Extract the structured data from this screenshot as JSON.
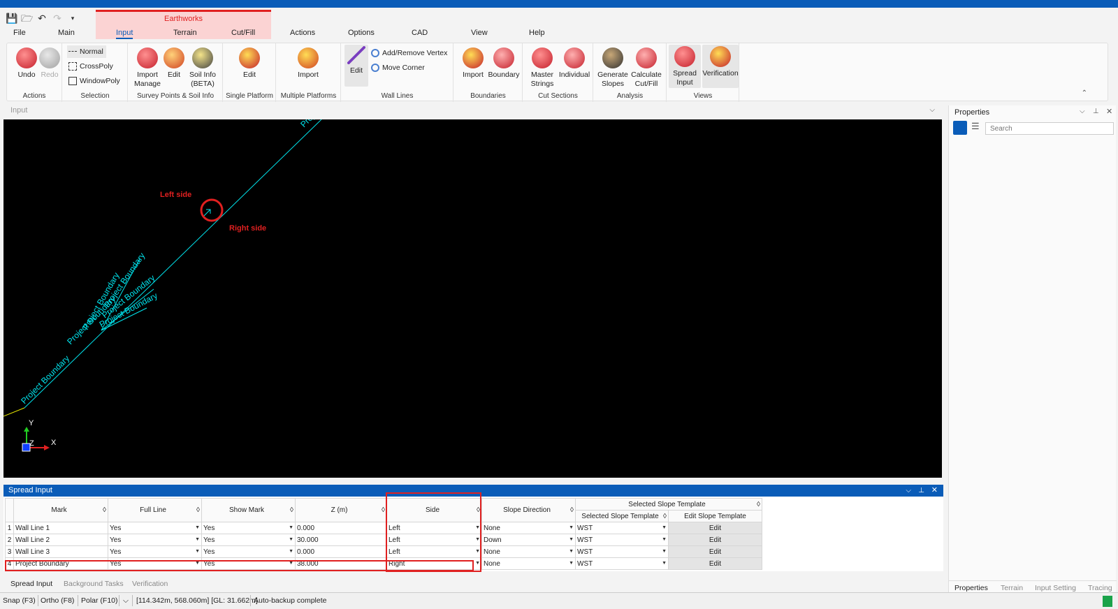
{
  "quick_access": [
    "save-icon",
    "open-folder-icon",
    "undo-icon",
    "redo-icon",
    "customize-icon"
  ],
  "ribbon": {
    "context_group": "Earthworks",
    "tabs": [
      "File",
      "Main",
      "Input",
      "Terrain",
      "Cut/Fill",
      "Actions",
      "Options",
      "CAD",
      "View",
      "Help"
    ],
    "active_tab": "Input",
    "groups": {
      "actions": {
        "label": "Actions",
        "undo": "Undo",
        "redo": "Redo"
      },
      "selection": {
        "label": "Selection",
        "normal": "Normal",
        "crosspoly": "CrossPoly",
        "windowpoly": "WindowPoly"
      },
      "survey": {
        "label": "Survey Points & Soil Info",
        "import_manage": "Import\nManage",
        "edit": "Edit",
        "soil_info": "Soil Info\n(BETA)"
      },
      "single_platform": {
        "label": "Single Platform",
        "edit": "Edit"
      },
      "multiple_platforms": {
        "label": "Multiple Platforms",
        "import": "Import"
      },
      "wall_lines": {
        "label": "Wall Lines",
        "edit": "Edit",
        "add_remove_vertex": "Add/Remove Vertex",
        "move_corner": "Move Corner"
      },
      "boundaries": {
        "label": "Boundaries",
        "import": "Import",
        "boundary": "Boundary"
      },
      "cut_sections": {
        "label": "Cut Sections",
        "master_strings": "Master\nStrings",
        "individual": "Individual"
      },
      "analysis": {
        "label": "Analysis",
        "generate_slopes": "Generate\nSlopes",
        "calculate_cutfill": "Calculate\nCut/Fill"
      },
      "views": {
        "label": "Views",
        "spread_input": "Spread\nInput",
        "verification": "Verification"
      }
    }
  },
  "input_pane": {
    "title": "Input"
  },
  "viewport": {
    "annotation_left": "Left side",
    "annotation_right": "Right side",
    "line_label": "Project Boundary",
    "axis_y": "Y",
    "axis_x": "X",
    "axis_z": "Z"
  },
  "properties": {
    "title": "Properties",
    "search_placeholder": "Search",
    "tabs": [
      "Properties",
      "Terrain",
      "Input Setting",
      "Tracing"
    ]
  },
  "spread_input": {
    "title": "Spread Input",
    "columns": [
      "Mark",
      "Full Line",
      "Show Mark",
      "Z (m)",
      "Side",
      "Slope Direction",
      "Selected Slope Template",
      "Edit Slope Template"
    ],
    "group_header": "Selected Slope Template",
    "rows": [
      {
        "n": "1",
        "mark": "Wall Line 1",
        "full": "Yes",
        "show": "Yes",
        "z": "0.000",
        "side": "Left",
        "dir": "None",
        "tpl": "WST",
        "edit": "Edit"
      },
      {
        "n": "2",
        "mark": "Wall Line 2",
        "full": "Yes",
        "show": "Yes",
        "z": "30.000",
        "side": "Left",
        "dir": "Down",
        "tpl": "WST",
        "edit": "Edit"
      },
      {
        "n": "3",
        "mark": "Wall Line 3",
        "full": "Yes",
        "show": "Yes",
        "z": "0.000",
        "side": "Left",
        "dir": "None",
        "tpl": "WST",
        "edit": "Edit"
      },
      {
        "n": "4",
        "mark": "Project Boundary",
        "full": "Yes",
        "show": "Yes",
        "z": "38.000",
        "side": "Right",
        "dir": "None",
        "tpl": "WST",
        "edit": "Edit"
      }
    ]
  },
  "bottom_tabs": [
    "Spread Input",
    "Background Tasks",
    "Verification"
  ],
  "status": {
    "snap": "Snap (F3)",
    "ortho": "Ortho (F8)",
    "polar": "Polar (F10)",
    "coords": "[114.342m, 568.060m] [GL: 31.662m]",
    "message": "Auto-backup complete"
  },
  "colors": {
    "accent": "#0a5cb8",
    "highlight": "#e02020",
    "cyan": "#00e5ee"
  }
}
